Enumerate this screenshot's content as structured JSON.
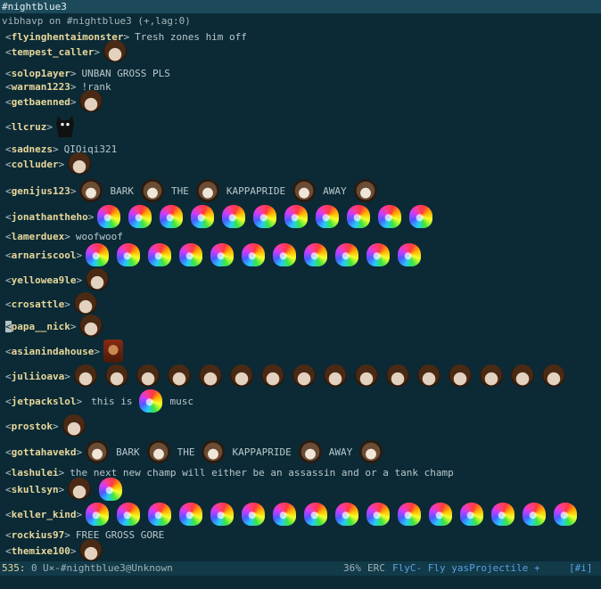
{
  "window": {
    "title": "#nightblue3"
  },
  "header": {
    "text": "vibhavp on #nightblue3 (+,lag:0)"
  },
  "messages": [
    {
      "nick": "flyinghentaimonster",
      "text": "Tresh zones him off"
    },
    {
      "nick": "tempest_caller",
      "text": "",
      "emotes": [
        "bob"
      ]
    },
    {
      "nick": "solop1ayer",
      "text": "UNBAN GROSS PLS"
    },
    {
      "nick": "warman1223",
      "text": "!rank"
    },
    {
      "nick": "getbaenned",
      "text": "",
      "emotes": [
        "bob"
      ]
    },
    {
      "nick": "llcruz",
      "text": "",
      "emotes": [
        "cat"
      ]
    },
    {
      "nick": "sadnezs",
      "text": "QIOiqi321"
    },
    {
      "nick": "colluder",
      "text": "",
      "emotes": [
        "bob"
      ]
    },
    {
      "nick": "genijus123",
      "text": "",
      "sequence": [
        "dog",
        "BARK",
        "dog",
        "THE",
        "dog",
        "KAPPAPRIDE",
        "dog",
        "AWAY",
        "dog"
      ]
    },
    {
      "nick": "jonathantheho",
      "text": "",
      "emotes": [
        "rainbow",
        "rainbow",
        "rainbow",
        "rainbow",
        "rainbow",
        "rainbow",
        "rainbow",
        "rainbow",
        "rainbow",
        "rainbow",
        "rainbow"
      ]
    },
    {
      "nick": "lamerduex",
      "text": "woofwoof"
    },
    {
      "nick": "arnariscool",
      "text": "",
      "emotes": [
        "rainbow",
        "rainbow",
        "rainbow",
        "rainbow",
        "rainbow",
        "rainbow",
        "rainbow",
        "rainbow",
        "rainbow",
        "rainbow",
        "rainbow"
      ]
    },
    {
      "nick": "yellowea9le",
      "text": "",
      "emotes": [
        "bob"
      ]
    },
    {
      "nick": "crosattle",
      "text": "",
      "emotes": [
        "bob"
      ]
    },
    {
      "nick": "papa__nick",
      "text": "",
      "emotes": [
        "bob"
      ],
      "cursor": true
    },
    {
      "nick": "asianindahouse",
      "text": "",
      "emotes": [
        "doom"
      ]
    },
    {
      "nick": "juliioava",
      "text": "",
      "emotes": [
        "bob",
        "bob",
        "bob",
        "bob",
        "bob",
        "bob",
        "bob",
        "bob",
        "bob",
        "bob",
        "bob",
        "bob",
        "bob",
        "bob",
        "bob",
        "bob"
      ]
    },
    {
      "nick": "jetpackslol",
      "text": "",
      "sequence": [
        "this is",
        "rainbow",
        "musc"
      ]
    },
    {
      "nick": "prostok",
      "text": "",
      "emotes": [
        "bob"
      ]
    },
    {
      "nick": "gottahavekd",
      "text": "",
      "sequence": [
        "dog",
        "BARK",
        "dog",
        "THE",
        "dog",
        "KAPPAPRIDE",
        "dog",
        "AWAY",
        "dog"
      ]
    },
    {
      "nick": "lashulei",
      "text": "the next new champ will either be an assassin and or a tank champ"
    },
    {
      "nick": "skullsyn",
      "text": "",
      "emotes": [
        "bob",
        "rainbow"
      ]
    },
    {
      "nick": "keller_kind",
      "text": "",
      "emotes": [
        "rainbow",
        "rainbow",
        "rainbow",
        "rainbow",
        "rainbow",
        "rainbow",
        "rainbow",
        "rainbow",
        "rainbow",
        "rainbow",
        "rainbow",
        "rainbow",
        "rainbow",
        "rainbow",
        "rainbow",
        "rainbow"
      ]
    },
    {
      "nick": "rockius97",
      "text": "FREE GROSS GORE"
    },
    {
      "nick": "themixe100",
      "text": "",
      "emotes": [
        "bob"
      ]
    }
  ],
  "modeline": {
    "line": "535:",
    "col": "0",
    "buffer": "U×-#nightblue3@Unknown",
    "percent": "36%",
    "mode": "ERC",
    "minor_modes": "FlyC- Fly yasProjectile +",
    "channel_status": "[#i]"
  }
}
